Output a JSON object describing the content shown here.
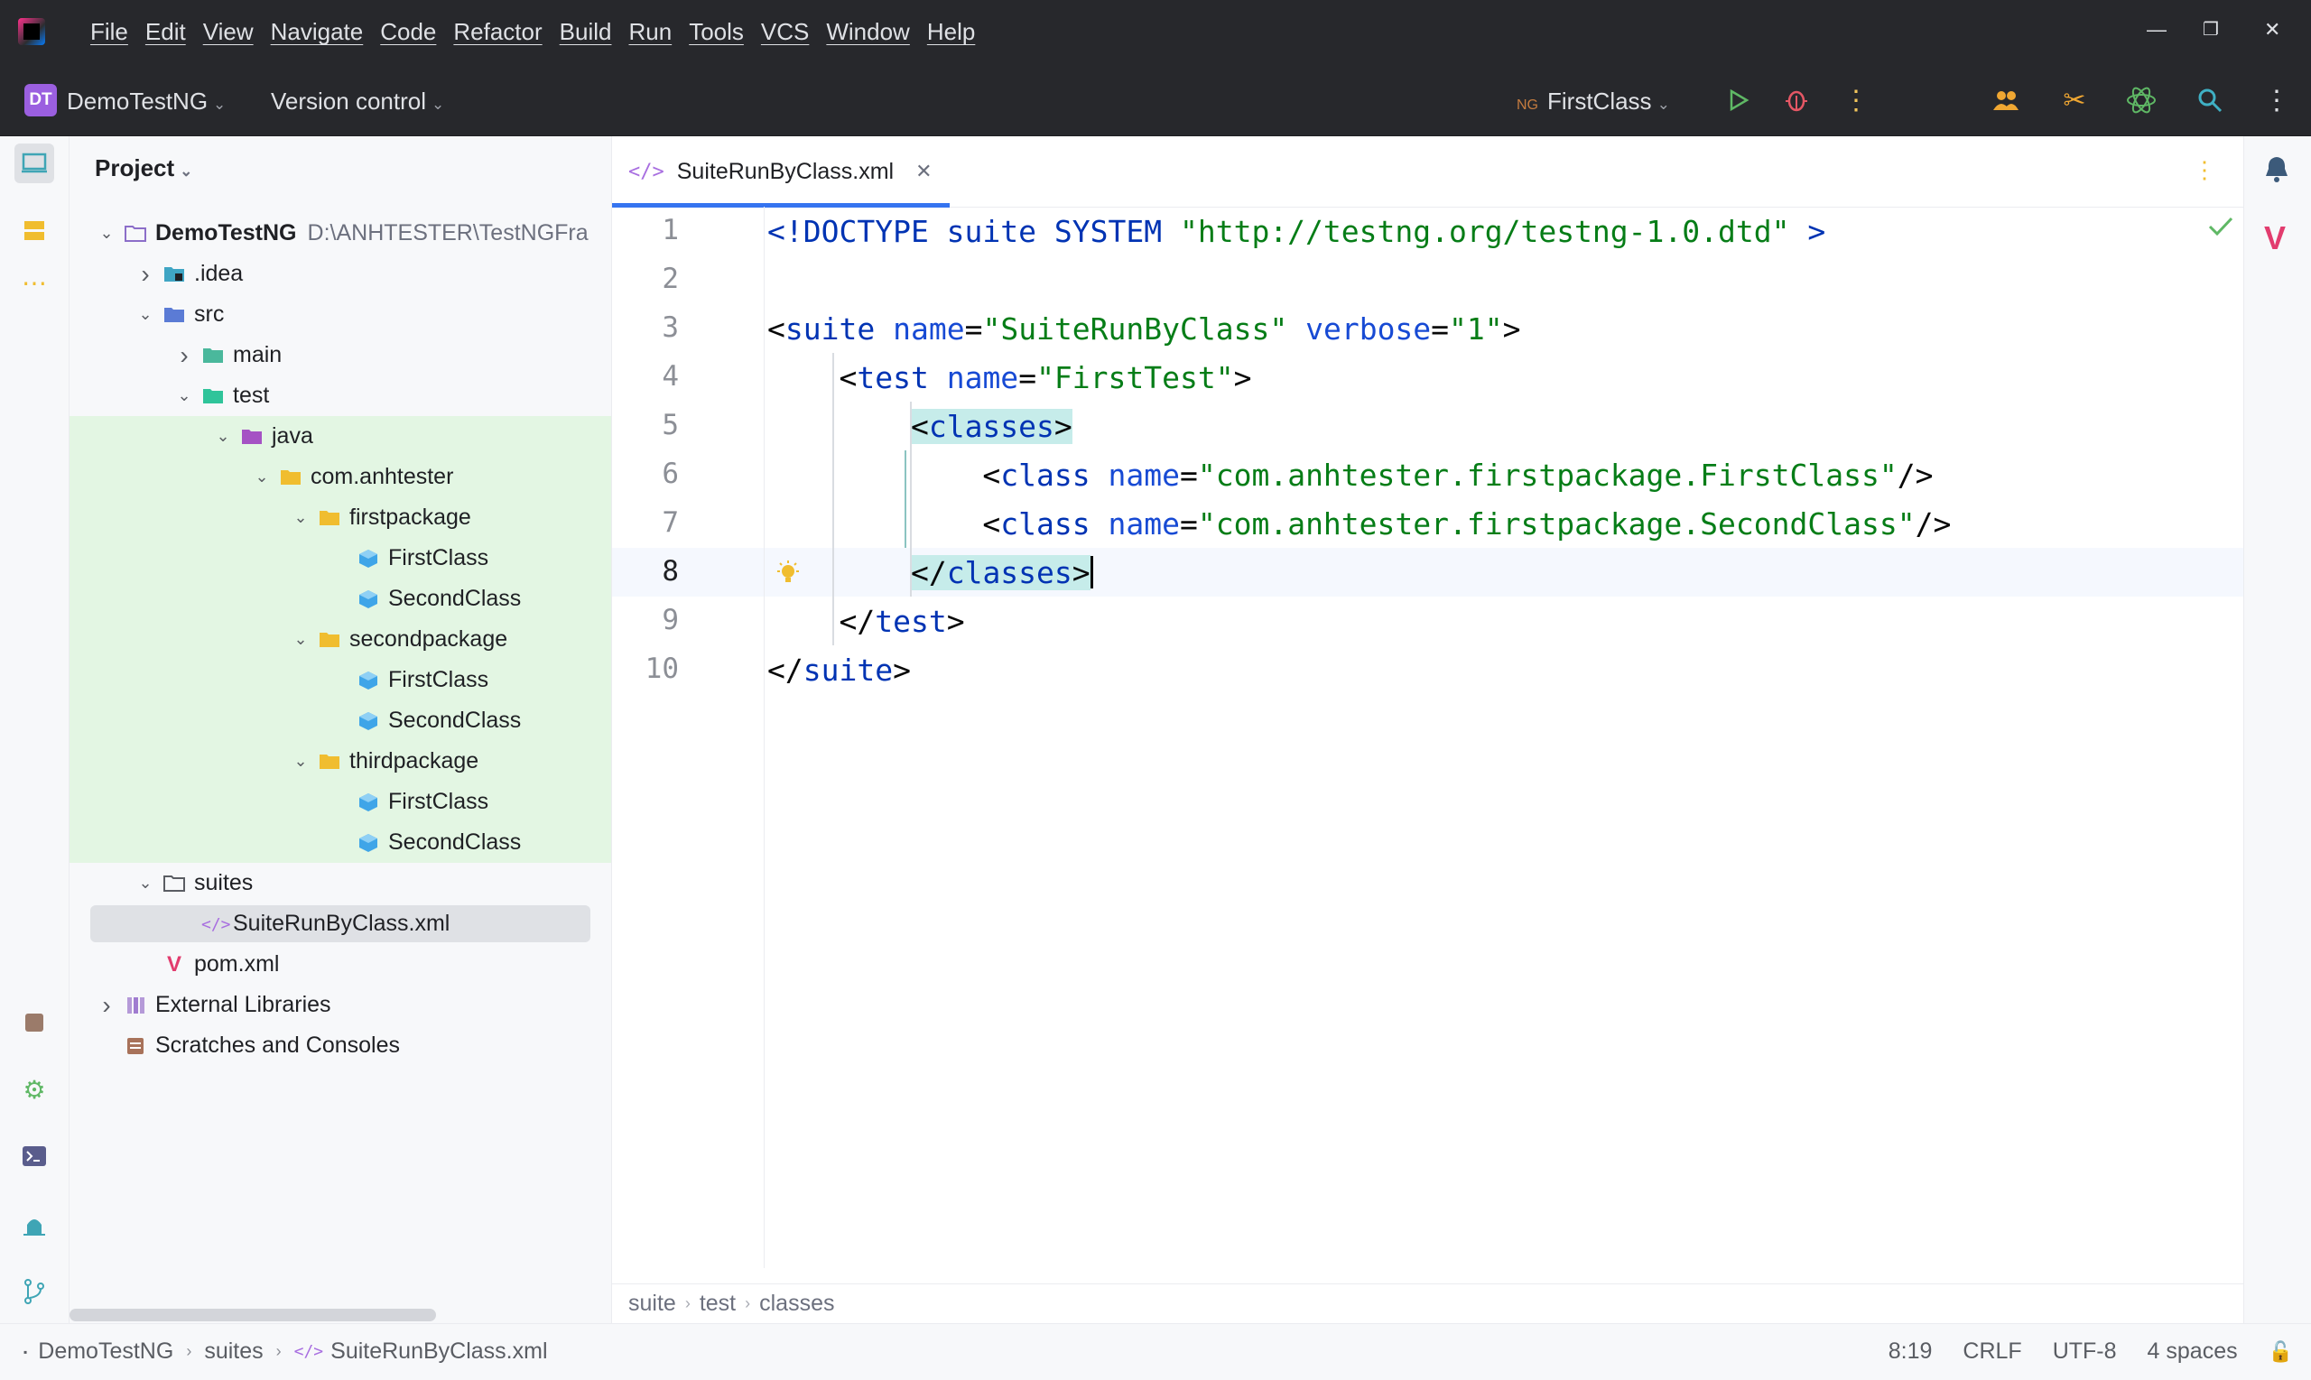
{
  "menu": [
    "File",
    "Edit",
    "View",
    "Navigate",
    "Code",
    "Refactor",
    "Build",
    "Run",
    "Tools",
    "VCS",
    "Window",
    "Help"
  ],
  "toolbar": {
    "project_badge": "DT",
    "project_name": "DemoTestNG",
    "vcs_label": "Version control",
    "run_config_icon_text": "NG",
    "run_config": "FirstClass"
  },
  "project_panel": {
    "title": "Project",
    "tree": [
      {
        "label": "DemoTestNG",
        "hint": "D:\\ANHTESTER\\TestNGFra",
        "depth": 0,
        "expanded": true,
        "icon": "module-folder-icon",
        "bold": true
      },
      {
        "label": ".idea",
        "depth": 1,
        "expanded": false,
        "icon": "idea-folder-icon"
      },
      {
        "label": "src",
        "depth": 1,
        "expanded": true,
        "icon": "source-root-folder-icon"
      },
      {
        "label": "main",
        "depth": 2,
        "expanded": false,
        "icon": "main-folder-icon"
      },
      {
        "label": "test",
        "depth": 2,
        "expanded": true,
        "icon": "test-folder-icon"
      },
      {
        "label": "java",
        "depth": 3,
        "expanded": true,
        "icon": "test-source-root-icon",
        "green": true
      },
      {
        "label": "com.anhtester",
        "depth": 4,
        "expanded": true,
        "icon": "package-icon",
        "green": true
      },
      {
        "label": "firstpackage",
        "depth": 5,
        "expanded": true,
        "icon": "package-icon",
        "green": true
      },
      {
        "label": "FirstClass",
        "depth": 6,
        "icon": "java-class-icon",
        "green": true
      },
      {
        "label": "SecondClass",
        "depth": 6,
        "icon": "java-class-icon",
        "green": true
      },
      {
        "label": "secondpackage",
        "depth": 5,
        "expanded": true,
        "icon": "package-icon",
        "green": true
      },
      {
        "label": "FirstClass",
        "depth": 6,
        "icon": "java-class-icon",
        "green": true
      },
      {
        "label": "SecondClass",
        "depth": 6,
        "icon": "java-class-icon",
        "green": true
      },
      {
        "label": "thirdpackage",
        "depth": 5,
        "expanded": true,
        "icon": "package-icon",
        "green": true
      },
      {
        "label": "FirstClass",
        "depth": 6,
        "icon": "java-class-icon",
        "green": true
      },
      {
        "label": "SecondClass",
        "depth": 6,
        "icon": "java-class-icon",
        "green": true
      },
      {
        "label": "suites",
        "depth": 1,
        "expanded": true,
        "icon": "folder-icon"
      },
      {
        "label": "SuiteRunByClass.xml",
        "depth": 2,
        "icon": "xml-file-icon",
        "selected": true
      },
      {
        "label": "pom.xml",
        "depth": 1,
        "icon": "maven-icon"
      },
      {
        "label": "External Libraries",
        "depth": 0,
        "expanded": false,
        "icon": "libraries-icon"
      },
      {
        "label": "Scratches and Consoles",
        "depth": 0,
        "icon": "scratches-icon"
      }
    ]
  },
  "editor": {
    "tab_label": "SuiteRunByClass.xml",
    "current_line": 8,
    "lines": [
      {
        "n": "1",
        "parts": [
          [
            "tag",
            "<!DOCTYPE suite SYSTEM "
          ],
          [
            "val",
            "\"http://testng.org/testng-1.0.dtd\""
          ],
          [
            "tag",
            " >"
          ]
        ]
      },
      {
        "n": "2",
        "parts": []
      },
      {
        "n": "3",
        "parts": [
          [
            "p",
            "<"
          ],
          [
            "tag",
            "suite"
          ],
          [
            "p",
            " "
          ],
          [
            "attr",
            "name"
          ],
          [
            "p",
            "="
          ],
          [
            "val",
            "\"SuiteRunByClass\""
          ],
          [
            "p",
            " "
          ],
          [
            "attr",
            "verbose"
          ],
          [
            "p",
            "="
          ],
          [
            "val",
            "\"1\""
          ],
          [
            "p",
            ">"
          ]
        ]
      },
      {
        "n": "4",
        "parts": [
          [
            "p",
            "    <"
          ],
          [
            "tag",
            "test"
          ],
          [
            "p",
            " "
          ],
          [
            "attr",
            "name"
          ],
          [
            "p",
            "="
          ],
          [
            "val",
            "\"FirstTest\""
          ],
          [
            "p",
            ">"
          ]
        ]
      },
      {
        "n": "5",
        "parts": [
          [
            "p",
            "        "
          ],
          [
            "hl",
            "<classes>"
          ]
        ]
      },
      {
        "n": "6",
        "parts": [
          [
            "p",
            "            <"
          ],
          [
            "tag",
            "class"
          ],
          [
            "p",
            " "
          ],
          [
            "attr",
            "name"
          ],
          [
            "p",
            "="
          ],
          [
            "val",
            "\"com.anhtester.firstpackage.FirstClass\""
          ],
          [
            "p",
            "/>"
          ]
        ]
      },
      {
        "n": "7",
        "parts": [
          [
            "p",
            "            <"
          ],
          [
            "tag",
            "class"
          ],
          [
            "p",
            " "
          ],
          [
            "attr",
            "name"
          ],
          [
            "p",
            "="
          ],
          [
            "val",
            "\"com.anhtester.firstpackage.SecondClass\""
          ],
          [
            "p",
            "/>"
          ]
        ]
      },
      {
        "n": "8",
        "parts": [
          [
            "p",
            "        "
          ],
          [
            "hl",
            "</classes>"
          ]
        ]
      },
      {
        "n": "9",
        "parts": [
          [
            "p",
            "    </"
          ],
          [
            "tag",
            "test"
          ],
          [
            "p",
            ">"
          ]
        ]
      },
      {
        "n": "10",
        "parts": [
          [
            "p",
            "</"
          ],
          [
            "tag",
            "suite"
          ],
          [
            "p",
            ">"
          ]
        ]
      }
    ],
    "breadcrumbs": [
      "suite",
      "test",
      "classes"
    ]
  },
  "statusbar": {
    "path": [
      "DemoTestNG",
      "suites",
      "SuiteRunByClass.xml"
    ],
    "position": "8:19",
    "line_sep": "CRLF",
    "encoding": "UTF-8",
    "indent": "4 spaces"
  },
  "colors": {
    "tag": "#0033b3",
    "attr": "#174ad4",
    "value": "#067d17",
    "test_highlight": "#e3f6e3",
    "accent": "#3574f0"
  }
}
